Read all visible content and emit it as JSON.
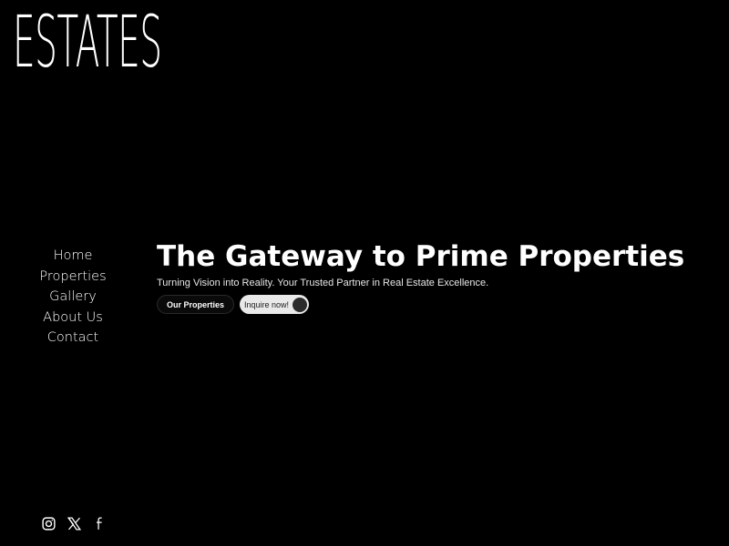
{
  "brand": {
    "logo_text": "ESTATES"
  },
  "nav": {
    "items": [
      {
        "label": "Home"
      },
      {
        "label": "Properties"
      },
      {
        "label": "Gallery"
      },
      {
        "label": "About Us"
      },
      {
        "label": "Contact"
      }
    ]
  },
  "hero": {
    "title": "The Gateway to Prime Properties",
    "subtitle": "Turning Vision into Reality. Your Trusted Partner in Real Estate Excellence.",
    "primary_button_label": "Our Properties",
    "secondary_button_label": "Inquire now!"
  },
  "social": {
    "icons": [
      "instagram-icon",
      "x-icon",
      "facebook-icon"
    ]
  },
  "colors": {
    "background": "#000000",
    "text": "#ffffff",
    "pill_bg": "#e9e9e9",
    "knob": "#2b2b2b"
  }
}
